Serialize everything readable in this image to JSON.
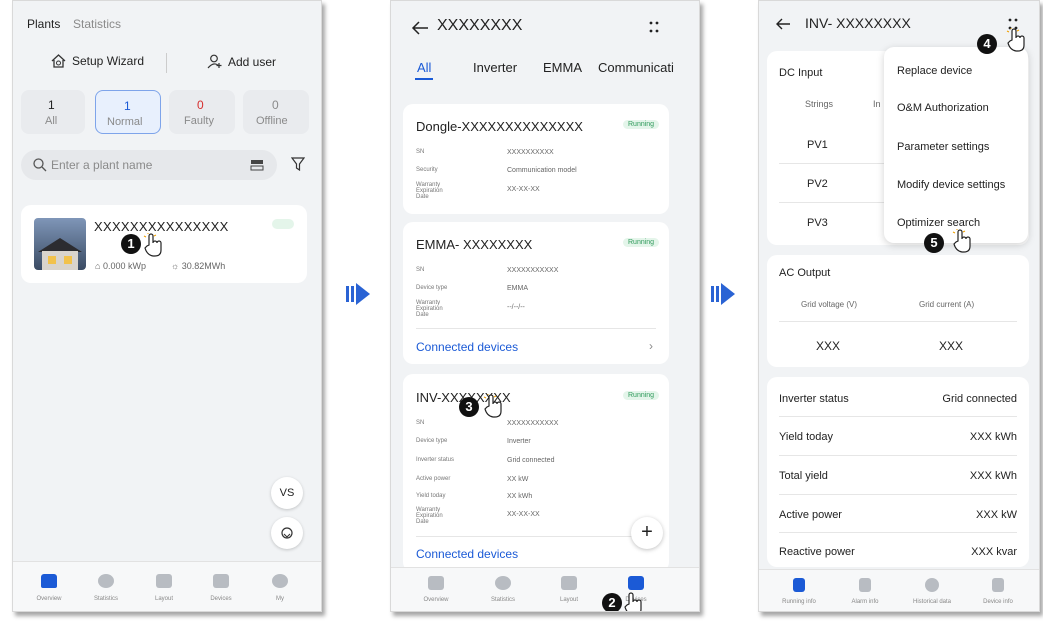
{
  "phone1": {
    "tabs": [
      "Plants",
      "Statistics"
    ],
    "setup_wizard": "Setup Wizard",
    "add_user": "Add user",
    "filters": [
      {
        "count": "1",
        "label": "All"
      },
      {
        "count": "1",
        "label": "Normal"
      },
      {
        "count": "0",
        "label": "Faulty"
      },
      {
        "count": "0",
        "label": "Offline"
      }
    ],
    "search_placeholder": "Enter a plant name",
    "plant": {
      "name": "XXXXXXXXXXXXXXX",
      "capacity": "0.000 kWp",
      "energy": "30.82MWh"
    },
    "float_vs": "VS",
    "nav": [
      "Overview",
      "Statistics",
      "Layout",
      "Devices",
      "My"
    ],
    "step": "1"
  },
  "phone2": {
    "title": "XXXXXXXX",
    "tabs": [
      "All",
      "Inverter",
      "EMMA",
      "Communicati"
    ],
    "devices": [
      {
        "name": "Dongle-XXXXXXXXXXXXXX",
        "status": "Running",
        "rows": [
          [
            "SN",
            "XXXXXXXXXX"
          ],
          [
            "Security",
            "Communication model"
          ],
          [
            "Warranty Expiration Date",
            "XX-XX-XX"
          ]
        ]
      },
      {
        "name": "EMMA- XXXXXXXX",
        "status": "Running",
        "rows": [
          [
            "SN",
            "XXXXXXXXXXX"
          ],
          [
            "Device type",
            "EMMA"
          ],
          [
            "Warranty Expiration Date",
            "--/--/--"
          ]
        ],
        "link": "Connected devices"
      },
      {
        "name": "INV-XXXXXXXX",
        "status": "Running",
        "rows": [
          [
            "SN",
            "XXXXXXXXXXX"
          ],
          [
            "Device type",
            "Inverter"
          ],
          [
            "Inverter status",
            "Grid connected"
          ],
          [
            "Active power",
            "XX kW"
          ],
          [
            "Yield today",
            "XX kWh"
          ],
          [
            "Warranty Expiration Date",
            "XX-XX-XX"
          ]
        ],
        "link": "Connected devices"
      }
    ],
    "nav": [
      "Overview",
      "Statistics",
      "Layout",
      "Devices"
    ],
    "steps": [
      "2",
      "3"
    ]
  },
  "phone3": {
    "title": "INV- XXXXXXXX",
    "dc_input": "DC Input",
    "strings_col": "Strings",
    "in_col": "In",
    "pv_rows": [
      "PV1",
      "PV2",
      "PV3"
    ],
    "menu": [
      "Replace device",
      "O&M Authorization",
      "Parameter settings",
      "Modify device settings",
      "Optimizer search"
    ],
    "ac_output": "AC Output",
    "grid_voltage_label": "Grid voltage (V)",
    "grid_current_label": "Grid current (A)",
    "grid_voltage": "XXX",
    "grid_current": "XXX",
    "info": [
      [
        "Inverter status",
        "Grid connected"
      ],
      [
        "Yield today",
        "XXX kWh"
      ],
      [
        "Total yield",
        "XXX kWh"
      ],
      [
        "Active power",
        "XXX kW"
      ],
      [
        "Reactive power",
        "XXX kvar"
      ]
    ],
    "nav": [
      "Running info",
      "Alarm info",
      "Historical data",
      "Device info"
    ],
    "steps": [
      "4",
      "5"
    ]
  },
  "colors": {
    "accent": "#1b5ad6",
    "running": "#2f9a5b",
    "faulty": "#d62f2f",
    "arrow": "#2a63d4"
  }
}
